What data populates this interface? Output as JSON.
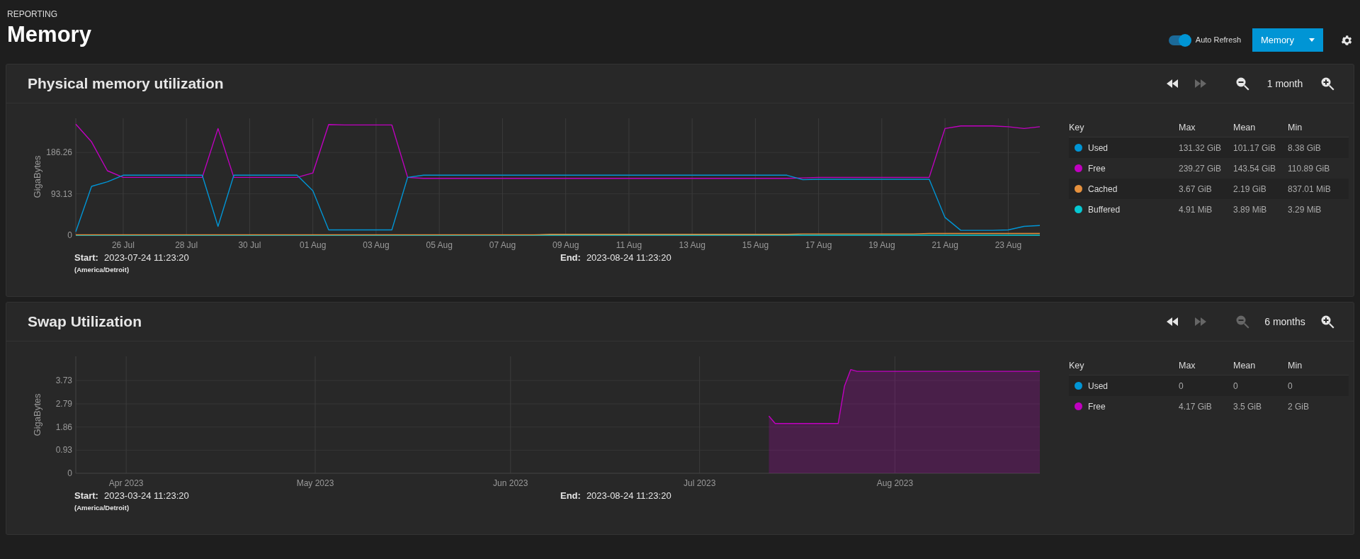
{
  "header": {
    "breadcrumb": "REPORTING",
    "title": "Memory",
    "auto_refresh": {
      "label": "Auto Refresh",
      "on": true
    },
    "report_button": {
      "label": "Memory"
    }
  },
  "panels": [
    {
      "title": "Physical memory utilization",
      "toolbar": [
        {
          "kind": "rewind",
          "disabled": false
        },
        {
          "kind": "forward",
          "disabled": true
        },
        {
          "kind": "zoom_out",
          "disabled": false
        },
        {
          "kind": "range",
          "label": "1 month"
        },
        {
          "kind": "zoom_in",
          "disabled": false
        }
      ],
      "chart_data": {
        "type": "line",
        "grid": true,
        "ylabel": "GigaBytes",
        "ylim": [
          0,
          263
        ],
        "categories": [
          null,
          null,
          null,
          "26 Jul",
          null,
          null,
          null,
          "28 Jul",
          null,
          null,
          null,
          "30 Jul",
          null,
          null,
          null,
          "01 Aug",
          null,
          null,
          null,
          "03 Aug",
          null,
          null,
          null,
          "05 Aug",
          null,
          null,
          null,
          "07 Aug",
          null,
          null,
          null,
          "09 Aug",
          null,
          null,
          null,
          "11 Aug",
          null,
          null,
          null,
          "13 Aug",
          null,
          null,
          null,
          "15 Aug",
          null,
          null,
          null,
          "17 Aug",
          null,
          null,
          null,
          "19 Aug",
          null,
          null,
          null,
          "21 Aug",
          null,
          null,
          null,
          "23 Aug",
          null,
          null
        ],
        "yticks": [
          0,
          93.13,
          186.26
        ],
        "series": [
          {
            "name": "Used",
            "color": "#0095d5",
            "values": [
              8,
              110,
              120,
              135,
              135,
              135,
              135,
              135,
              135,
              20,
              135,
              135,
              135,
              135,
              135,
              100,
              12,
              12,
              12,
              12,
              12,
              130,
              135,
              135,
              135,
              135,
              135,
              135,
              135,
              135,
              135,
              135,
              135,
              135,
              135,
              135,
              135,
              135,
              135,
              135,
              135,
              135,
              135,
              135,
              135,
              135,
              125,
              126,
              126,
              126,
              126,
              126,
              126,
              126,
              126,
              40,
              11,
              11,
              11,
              12,
              20,
              22
            ]
          },
          {
            "name": "Free",
            "color": "#c000c0",
            "values": [
              250,
              210,
              145,
              130,
              130,
              130,
              130,
              130,
              130,
              240,
              130,
              130,
              130,
              130,
              130,
              140,
              249,
              248,
              248,
              248,
              248,
              130,
              128,
              128,
              128,
              128,
              128,
              128,
              128,
              128,
              128,
              128,
              128,
              128,
              128,
              128,
              128,
              128,
              128,
              128,
              128,
              128,
              128,
              128,
              128,
              128,
              129,
              130,
              130,
              130,
              130,
              130,
              130,
              130,
              130,
              240,
              246,
              246,
              246,
              244,
              240,
              244
            ]
          },
          {
            "name": "Cached",
            "color": "#e6913d",
            "values": [
              1,
              1,
              1,
              1,
              1,
              1,
              1,
              1,
              1,
              1,
              1,
              1,
              1,
              1,
              1,
              1,
              1,
              1,
              1,
              1,
              1,
              1,
              1,
              1,
              1,
              1,
              1,
              1,
              1,
              1,
              2,
              2,
              2,
              2,
              2,
              2,
              2,
              2,
              2,
              2,
              2,
              2,
              2,
              2,
              2,
              2,
              3,
              3,
              3,
              3,
              3,
              3,
              3,
              3,
              4,
              4,
              4,
              4,
              4,
              4,
              4,
              4
            ]
          },
          {
            "name": "Buffered",
            "color": "#06c8d2",
            "values": [
              0,
              0,
              0,
              0,
              0,
              0,
              0,
              0,
              0,
              0,
              0,
              0,
              0,
              0,
              0,
              0,
              0,
              0,
              0,
              0,
              0,
              0,
              0,
              0,
              0,
              0,
              0,
              0,
              0,
              0,
              0,
              0,
              0,
              0,
              0,
              0,
              0,
              0,
              0,
              0,
              0,
              0,
              0,
              0,
              0,
              0,
              0,
              0,
              0,
              0,
              0,
              0,
              0,
              0,
              0,
              0,
              0,
              0,
              0,
              0,
              0,
              0
            ]
          }
        ]
      },
      "range": {
        "start_label": "Start:",
        "start": "2023-07-24 11:23:20",
        "timezone": "(America/Detroit)",
        "end_label": "End:",
        "end": "2023-08-24 11:23:20"
      },
      "legend": {
        "columns": [
          "Key",
          "Max",
          "Mean",
          "Min"
        ],
        "rows": [
          {
            "max": "131.32 GiB",
            "mean": "101.17 GiB",
            "min": "8.38 GiB"
          },
          {
            "max": "239.27 GiB",
            "mean": "143.54 GiB",
            "min": "110.89 GiB"
          },
          {
            "max": "3.67 GiB",
            "mean": "2.19 GiB",
            "min": "837.01 MiB"
          },
          {
            "max": "4.91 MiB",
            "mean": "3.89 MiB",
            "min": "3.29 MiB"
          }
        ]
      }
    },
    {
      "title": "Swap Utilization",
      "toolbar": [
        {
          "kind": "rewind",
          "disabled": false
        },
        {
          "kind": "forward",
          "disabled": true
        },
        {
          "kind": "zoom_out",
          "disabled": true
        },
        {
          "kind": "range",
          "label": "6 months"
        },
        {
          "kind": "zoom_in",
          "disabled": false
        }
      ],
      "chart_data": {
        "type": "area",
        "grid": true,
        "ylabel": "GigaBytes",
        "ylim": [
          0,
          4.7
        ],
        "categories": [
          null,
          null,
          null,
          null,
          null,
          null,
          null,
          null,
          "Apr 2023",
          null,
          null,
          null,
          null,
          null,
          null,
          null,
          null,
          null,
          null,
          null,
          null,
          null,
          null,
          null,
          null,
          null,
          null,
          null,
          null,
          null,
          null,
          null,
          null,
          null,
          null,
          null,
          null,
          null,
          "May 2023",
          null,
          null,
          null,
          null,
          null,
          null,
          null,
          null,
          null,
          null,
          null,
          null,
          null,
          null,
          null,
          null,
          null,
          null,
          null,
          null,
          null,
          null,
          null,
          null,
          null,
          null,
          null,
          null,
          null,
          null,
          "Jun 2023",
          null,
          null,
          null,
          null,
          null,
          null,
          null,
          null,
          null,
          null,
          null,
          null,
          null,
          null,
          null,
          null,
          null,
          null,
          null,
          null,
          null,
          null,
          null,
          null,
          null,
          null,
          null,
          null,
          null,
          "Jul 2023",
          null,
          null,
          null,
          null,
          null,
          null,
          null,
          null,
          null,
          null,
          null,
          null,
          null,
          null,
          null,
          null,
          null,
          null,
          null,
          null,
          null,
          null,
          null,
          null,
          null,
          null,
          null,
          null,
          null,
          null,
          "Aug 2023",
          null,
          null,
          null,
          null,
          null,
          null,
          null,
          null,
          null,
          null,
          null,
          null,
          null,
          null,
          null,
          null,
          null,
          null,
          null,
          null,
          null,
          null,
          null
        ],
        "yticks": [
          0,
          0.93,
          1.86,
          2.79,
          3.73
        ],
        "series": [
          {
            "name": "Used",
            "color": "#0095d5",
            "values": [
              null,
              null,
              null,
              null,
              null,
              null,
              null,
              null,
              null,
              null,
              null,
              null,
              null,
              null,
              null,
              null,
              null,
              null,
              null,
              null,
              null,
              null,
              null,
              null,
              null,
              null,
              null,
              null,
              null,
              null,
              null,
              null,
              null,
              null,
              null,
              null,
              null,
              null,
              null,
              null,
              null,
              null,
              null,
              null,
              null,
              null,
              null,
              null,
              null,
              null,
              null,
              null,
              null,
              null,
              null,
              null,
              null,
              null,
              null,
              null,
              null,
              null,
              null,
              null,
              null,
              null,
              null,
              null,
              null,
              null,
              null,
              null,
              null,
              null,
              null,
              null,
              null,
              null,
              null,
              null,
              null,
              null,
              null,
              null,
              null,
              null,
              null,
              null,
              null,
              null,
              null,
              null,
              null,
              null,
              null,
              null,
              null,
              null,
              null,
              null,
              null,
              null,
              null,
              null,
              null,
              null,
              null,
              null,
              null,
              null,
              null,
              null,
              null,
              null,
              null,
              null,
              null,
              null,
              null,
              null,
              null,
              null,
              null,
              null,
              null,
              null,
              null,
              null,
              null,
              null,
              null,
              null,
              null,
              null,
              null,
              null,
              null,
              null,
              null,
              null,
              null,
              null,
              null,
              null,
              null,
              null,
              null,
              null,
              null,
              null,
              null,
              null,
              null,
              null
            ]
          },
          {
            "name": "Free",
            "color": "#c000c0",
            "values": [
              null,
              null,
              null,
              null,
              null,
              null,
              null,
              null,
              null,
              null,
              null,
              null,
              null,
              null,
              null,
              null,
              null,
              null,
              null,
              null,
              null,
              null,
              null,
              null,
              null,
              null,
              null,
              null,
              null,
              null,
              null,
              null,
              null,
              null,
              null,
              null,
              null,
              null,
              null,
              null,
              null,
              null,
              null,
              null,
              null,
              null,
              null,
              null,
              null,
              null,
              null,
              null,
              null,
              null,
              null,
              null,
              null,
              null,
              null,
              null,
              null,
              null,
              null,
              null,
              null,
              null,
              null,
              null,
              null,
              null,
              null,
              null,
              null,
              null,
              null,
              null,
              null,
              null,
              null,
              null,
              null,
              null,
              null,
              null,
              null,
              null,
              null,
              null,
              null,
              null,
              null,
              null,
              null,
              null,
              null,
              null,
              null,
              null,
              null,
              null,
              null,
              null,
              null,
              null,
              null,
              null,
              null,
              null,
              null,
              null,
              2.3,
              2,
              2,
              2,
              2,
              2,
              2,
              2,
              2,
              2,
              2,
              2,
              3.5,
              4.17,
              4.1,
              4.1,
              4.1,
              4.1,
              4.1,
              4.1,
              4.1,
              4.1,
              4.1,
              4.1,
              4.1,
              4.1,
              4.1,
              4.1,
              4.1,
              4.1,
              4.1,
              4.1,
              4.1,
              4.1,
              4.1,
              4.1,
              4.1,
              4.1,
              4.1,
              4.1,
              4.1,
              4.1,
              4.1,
              4.1
            ]
          }
        ]
      },
      "range": {
        "start_label": "Start:",
        "start": "2023-03-24 11:23:20",
        "timezone": "(America/Detroit)",
        "end_label": "End:",
        "end": "2023-08-24 11:23:20"
      },
      "legend": {
        "columns": [
          "Key",
          "Max",
          "Mean",
          "Min"
        ],
        "rows": [
          {
            "max": "0",
            "mean": "0",
            "min": "0"
          },
          {
            "max": "4.17 GiB",
            "mean": "3.5 GiB",
            "min": "2 GiB"
          }
        ]
      }
    }
  ]
}
